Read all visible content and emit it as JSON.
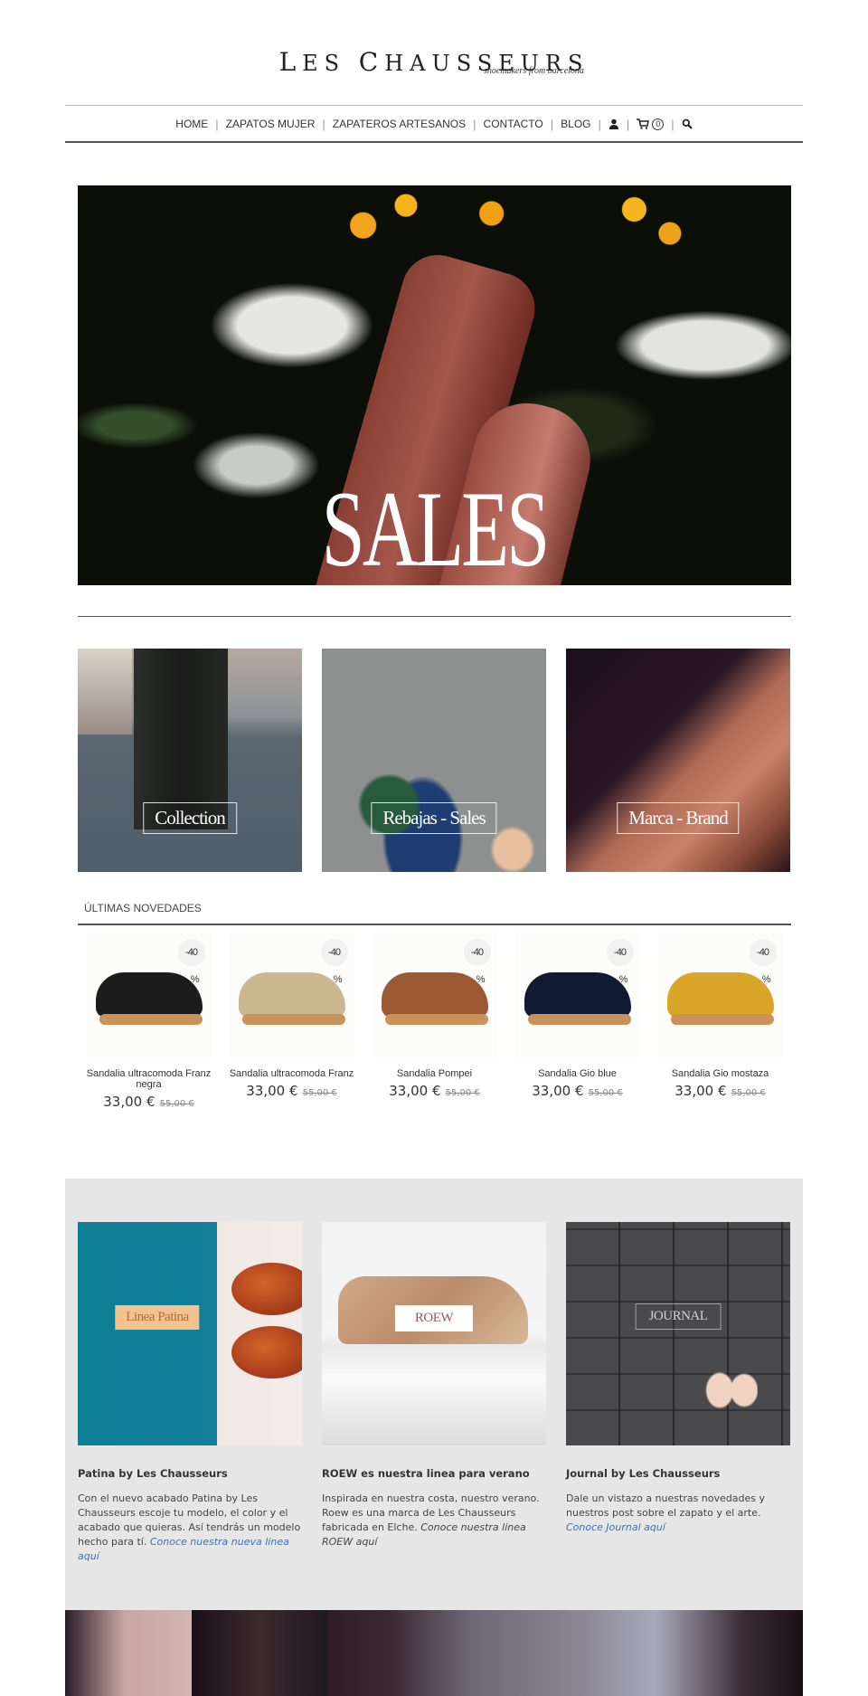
{
  "header": {
    "logo_text": "Les Chausseurs",
    "logo_first_l": "L",
    "logo_rest_1": "ES",
    "logo_first_c": "C",
    "logo_rest_2": "HAUSSEURS",
    "tagline": "shoemakers from barcelona"
  },
  "nav": {
    "items": [
      {
        "label": "HOME"
      },
      {
        "label": "ZAPATOS MUJER"
      },
      {
        "label": "ZAPATEROS ARTESANOS"
      },
      {
        "label": "CONTACTO"
      },
      {
        "label": "BLOG"
      }
    ],
    "separator": "|",
    "account_icon": "user-icon",
    "cart_icon": "cart-icon",
    "cart_count": "0",
    "search_icon": "search-icon"
  },
  "hero": {
    "text": "SALES"
  },
  "categories": [
    {
      "label": "Collection"
    },
    {
      "label": "Rebajas - Sales"
    },
    {
      "label": "Marca - Brand"
    }
  ],
  "novedades": {
    "title": "ÚLTIMAS NOVEDADES",
    "products": [
      {
        "name": "Sandalia ultracomoda Franz negra",
        "badge": "-40",
        "badge_pct": "%",
        "price": "33,00 €",
        "old_price": "55,00 €",
        "strap_color": "#1c1c1c"
      },
      {
        "name": "Sandalia ultracomoda Franz",
        "badge": "-40",
        "badge_pct": "%",
        "price": "33,00 €",
        "old_price": "55,00 €",
        "strap_color": "#cbb893"
      },
      {
        "name": "Sandalia Pompei",
        "badge": "-40",
        "badge_pct": "%",
        "price": "33,00 €",
        "old_price": "55,00 €",
        "strap_color": "#9c5a34"
      },
      {
        "name": "Sandalia Gio blue",
        "badge": "-40",
        "badge_pct": "%",
        "price": "33,00 €",
        "old_price": "55,00 €",
        "strap_color": "#111a33"
      },
      {
        "name": "Sandalia Gio mostaza",
        "badge": "-40",
        "badge_pct": "%",
        "price": "33,00 €",
        "old_price": "55,00 €",
        "strap_color": "#d9a62a"
      }
    ]
  },
  "features": [
    {
      "image_label": "Linea Patina",
      "title": "Patina by Les Chausseurs",
      "body": "Con el nuevo acabado Patina by Les Chausseurs escoje tu modelo, el color y el acabado que quieras. Así tendrás un modelo hecho para tí. ",
      "link": "Conoce nuestra nueva linea aquí"
    },
    {
      "image_label": "ROEW",
      "title": "ROEW es nuestra linea para verano",
      "body": "Inspirada en nuestra costa, nuestro verano. Roew es una marca de Les Chausseurs fabricada en Elche. ",
      "link": "Conoce nuestra linea ROEW aquí"
    },
    {
      "image_label": "JOURNAL",
      "title": "Journal by Les Chausseurs",
      "body": "Dale un vistazo a nuestras novedades y nuestros post sobre el zapato y el arte. ",
      "link": "Conoce Journal aquí"
    }
  ],
  "colors": {
    "link": "#3a74b8",
    "grey_section": "#e6e6e6",
    "text": "#333333"
  }
}
